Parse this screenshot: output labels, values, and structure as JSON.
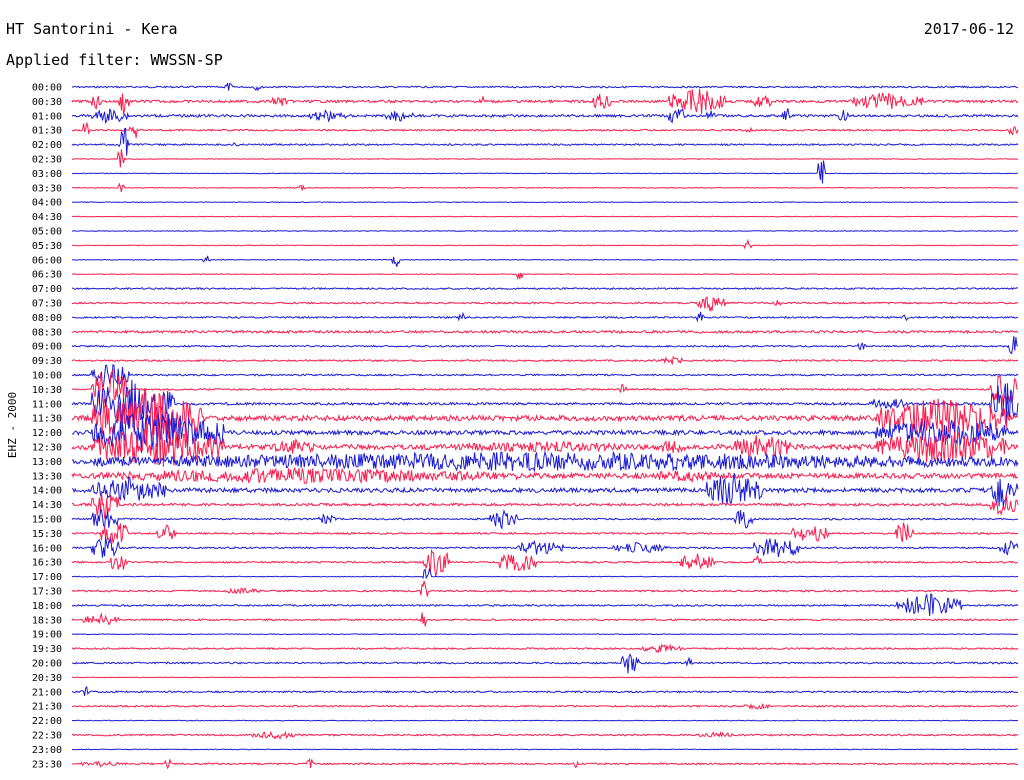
{
  "header": {
    "title": "HT Santorini - Kera",
    "date": "2017-06-12",
    "filter": "Applied filter: WWSSN-SP"
  },
  "chart_data": {
    "type": "line",
    "chart_kind": "helicorder",
    "channel_label": "EHZ - 2000",
    "colors": [
      "#1a1ad6",
      "#ff1a4b"
    ],
    "grid": false,
    "legend": "none",
    "rows": [
      {
        "label": "00:00",
        "level": 1,
        "events": [
          {
            "x": 0.16,
            "w": 0.01,
            "a": 5
          },
          {
            "x": 0.19,
            "w": 0.01,
            "a": 4
          }
        ]
      },
      {
        "label": "00:30",
        "level": 2,
        "events": [
          {
            "x": 0.02,
            "w": 0.01,
            "a": 8
          },
          {
            "x": 0.05,
            "w": 0.01,
            "a": 16
          },
          {
            "x": 0.21,
            "w": 0.02,
            "a": 6
          },
          {
            "x": 0.43,
            "w": 0.01,
            "a": 7
          },
          {
            "x": 0.55,
            "w": 0.02,
            "a": 10
          },
          {
            "x": 0.63,
            "w": 0.06,
            "a": 14
          },
          {
            "x": 0.72,
            "w": 0.02,
            "a": 8
          },
          {
            "x": 0.82,
            "w": 0.08,
            "a": 9
          }
        ]
      },
      {
        "label": "01:00",
        "level": 2,
        "events": [
          {
            "x": 0.02,
            "w": 0.04,
            "a": 8
          },
          {
            "x": 0.25,
            "w": 0.04,
            "a": 6
          },
          {
            "x": 0.33,
            "w": 0.03,
            "a": 6
          },
          {
            "x": 0.63,
            "w": 0.02,
            "a": 10
          },
          {
            "x": 0.67,
            "w": 0.01,
            "a": 6
          },
          {
            "x": 0.75,
            "w": 0.01,
            "a": 10
          },
          {
            "x": 0.81,
            "w": 0.01,
            "a": 9
          }
        ]
      },
      {
        "label": "01:30",
        "level": 1,
        "events": [
          {
            "x": 0.01,
            "w": 0.01,
            "a": 10
          },
          {
            "x": 0.06,
            "w": 0.01,
            "a": 14
          },
          {
            "x": 0.71,
            "w": 0.01,
            "a": 4
          },
          {
            "x": 0.99,
            "w": 0.01,
            "a": 6
          }
        ]
      },
      {
        "label": "02:00",
        "level": 1,
        "events": [
          {
            "x": 0.05,
            "w": 0.01,
            "a": 22
          },
          {
            "x": 0.17,
            "w": 0.005,
            "a": 4
          }
        ]
      },
      {
        "label": "02:30",
        "level": 0,
        "events": [
          {
            "x": 0.05,
            "w": 0.005,
            "a": 14
          }
        ]
      },
      {
        "label": "03:00",
        "level": 0,
        "events": [
          {
            "x": 0.79,
            "w": 0.005,
            "a": 20
          }
        ]
      },
      {
        "label": "03:30",
        "level": 0,
        "events": [
          {
            "x": 0.05,
            "w": 0.005,
            "a": 6
          },
          {
            "x": 0.24,
            "w": 0.005,
            "a": 3
          }
        ]
      },
      {
        "label": "04:00",
        "level": 0,
        "events": []
      },
      {
        "label": "04:30",
        "level": 0,
        "events": []
      },
      {
        "label": "05:00",
        "level": 0,
        "events": []
      },
      {
        "label": "05:30",
        "level": 0,
        "events": [
          {
            "x": 0.71,
            "w": 0.01,
            "a": 6
          }
        ]
      },
      {
        "label": "06:00",
        "level": 0,
        "events": [
          {
            "x": 0.14,
            "w": 0.005,
            "a": 5
          },
          {
            "x": 0.34,
            "w": 0.005,
            "a": 8
          }
        ]
      },
      {
        "label": "06:30",
        "level": 0,
        "events": [
          {
            "x": 0.47,
            "w": 0.005,
            "a": 8
          }
        ]
      },
      {
        "label": "07:00",
        "level": 1,
        "events": []
      },
      {
        "label": "07:30",
        "level": 1,
        "events": [
          {
            "x": 0.66,
            "w": 0.03,
            "a": 9
          },
          {
            "x": 0.74,
            "w": 0.01,
            "a": 4
          }
        ]
      },
      {
        "label": "08:00",
        "level": 1,
        "events": [
          {
            "x": 0.41,
            "w": 0.005,
            "a": 6
          },
          {
            "x": 0.66,
            "w": 0.01,
            "a": 6
          },
          {
            "x": 0.88,
            "w": 0.005,
            "a": 5
          }
        ]
      },
      {
        "label": "08:30",
        "level": 2,
        "events": []
      },
      {
        "label": "09:00",
        "level": 1,
        "events": [
          {
            "x": 0.83,
            "w": 0.01,
            "a": 4
          },
          {
            "x": 0.99,
            "w": 0.01,
            "a": 16
          }
        ]
      },
      {
        "label": "09:30",
        "level": 1,
        "events": [
          {
            "x": 0.62,
            "w": 0.03,
            "a": 4
          }
        ]
      },
      {
        "label": "10:00",
        "level": 1,
        "events": [
          {
            "x": 0.02,
            "w": 0.04,
            "a": 16
          }
        ]
      },
      {
        "label": "10:30",
        "level": 1,
        "events": [
          {
            "x": 0.02,
            "w": 0.04,
            "a": 22
          },
          {
            "x": 0.58,
            "w": 0.005,
            "a": 6
          },
          {
            "x": 0.97,
            "w": 0.03,
            "a": 20
          }
        ]
      },
      {
        "label": "11:00",
        "level": 2,
        "events": [
          {
            "x": 0.02,
            "w": 0.09,
            "a": 26
          },
          {
            "x": 0.84,
            "w": 0.04,
            "a": 8
          },
          {
            "x": 0.97,
            "w": 0.03,
            "a": 24
          }
        ]
      },
      {
        "label": "11:30",
        "level": 5,
        "events": [
          {
            "x": 0.02,
            "w": 0.12,
            "a": 30
          },
          {
            "x": 0.85,
            "w": 0.14,
            "a": 22
          }
        ]
      },
      {
        "label": "12:00",
        "level": 4,
        "events": [
          {
            "x": 0.02,
            "w": 0.14,
            "a": 24
          },
          {
            "x": 0.85,
            "w": 0.14,
            "a": 16
          }
        ]
      },
      {
        "label": "12:30",
        "level": 5,
        "events": [
          {
            "x": 0.02,
            "w": 0.14,
            "a": 22
          },
          {
            "x": 0.21,
            "w": 0.05,
            "a": 8
          },
          {
            "x": 0.4,
            "w": 0.2,
            "a": 6
          },
          {
            "x": 0.62,
            "w": 0.03,
            "a": 8
          },
          {
            "x": 0.7,
            "w": 0.06,
            "a": 14
          },
          {
            "x": 0.85,
            "w": 0.14,
            "a": 18
          }
        ]
      },
      {
        "label": "13:00",
        "level": 5,
        "events": [
          {
            "x": 0.02,
            "w": 0.98,
            "a": 10
          }
        ]
      },
      {
        "label": "13:30",
        "level": 5,
        "events": [
          {
            "x": 0.02,
            "w": 0.45,
            "a": 8
          },
          {
            "x": 0.6,
            "w": 0.1,
            "a": 6
          }
        ]
      },
      {
        "label": "14:00",
        "level": 4,
        "events": [
          {
            "x": 0.02,
            "w": 0.08,
            "a": 14
          },
          {
            "x": 0.67,
            "w": 0.06,
            "a": 18
          },
          {
            "x": 0.97,
            "w": 0.03,
            "a": 20
          }
        ]
      },
      {
        "label": "14:30",
        "level": 2,
        "events": [
          {
            "x": 0.02,
            "w": 0.03,
            "a": 16
          },
          {
            "x": 0.97,
            "w": 0.03,
            "a": 12
          }
        ]
      },
      {
        "label": "15:00",
        "level": 1,
        "events": [
          {
            "x": 0.02,
            "w": 0.03,
            "a": 12
          },
          {
            "x": 0.26,
            "w": 0.02,
            "a": 6
          },
          {
            "x": 0.44,
            "w": 0.03,
            "a": 10
          },
          {
            "x": 0.7,
            "w": 0.02,
            "a": 12
          }
        ]
      },
      {
        "label": "15:30",
        "level": 1,
        "events": [
          {
            "x": 0.03,
            "w": 0.03,
            "a": 14
          },
          {
            "x": 0.09,
            "w": 0.02,
            "a": 9
          },
          {
            "x": 0.76,
            "w": 0.04,
            "a": 10
          },
          {
            "x": 0.87,
            "w": 0.02,
            "a": 14
          }
        ]
      },
      {
        "label": "16:00",
        "level": 1,
        "events": [
          {
            "x": 0.02,
            "w": 0.03,
            "a": 14
          },
          {
            "x": 0.47,
            "w": 0.05,
            "a": 8
          },
          {
            "x": 0.57,
            "w": 0.06,
            "a": 6
          },
          {
            "x": 0.72,
            "w": 0.05,
            "a": 12
          },
          {
            "x": 0.98,
            "w": 0.02,
            "a": 8
          }
        ]
      },
      {
        "label": "16:30",
        "level": 1,
        "events": [
          {
            "x": 0.04,
            "w": 0.02,
            "a": 10
          },
          {
            "x": 0.37,
            "w": 0.03,
            "a": 16
          },
          {
            "x": 0.45,
            "w": 0.04,
            "a": 12
          },
          {
            "x": 0.64,
            "w": 0.04,
            "a": 10
          },
          {
            "x": 0.72,
            "w": 0.01,
            "a": 8
          }
        ]
      },
      {
        "label": "17:00",
        "level": 0,
        "events": [
          {
            "x": 0.37,
            "w": 0.01,
            "a": 12
          }
        ]
      },
      {
        "label": "17:30",
        "level": 1,
        "events": [
          {
            "x": 0.16,
            "w": 0.04,
            "a": 3
          },
          {
            "x": 0.37,
            "w": 0.005,
            "a": 14
          }
        ]
      },
      {
        "label": "18:00",
        "level": 1,
        "events": [
          {
            "x": 0.87,
            "w": 0.07,
            "a": 12
          }
        ]
      },
      {
        "label": "18:30",
        "level": 1,
        "events": [
          {
            "x": 0.01,
            "w": 0.04,
            "a": 6
          },
          {
            "x": 0.37,
            "w": 0.005,
            "a": 14
          }
        ]
      },
      {
        "label": "19:00",
        "level": 0,
        "events": []
      },
      {
        "label": "19:30",
        "level": 1,
        "events": [
          {
            "x": 0.6,
            "w": 0.05,
            "a": 4
          }
        ]
      },
      {
        "label": "20:00",
        "level": 1,
        "events": [
          {
            "x": 0.58,
            "w": 0.02,
            "a": 12
          },
          {
            "x": 0.65,
            "w": 0.005,
            "a": 6
          }
        ]
      },
      {
        "label": "20:30",
        "level": 0,
        "events": []
      },
      {
        "label": "21:00",
        "level": 1,
        "events": [
          {
            "x": 0.01,
            "w": 0.01,
            "a": 6
          }
        ]
      },
      {
        "label": "21:30",
        "level": 1,
        "events": [
          {
            "x": 0.71,
            "w": 0.03,
            "a": 3
          }
        ]
      },
      {
        "label": "22:00",
        "level": 0,
        "events": []
      },
      {
        "label": "22:30",
        "level": 1,
        "events": [
          {
            "x": 0.19,
            "w": 0.05,
            "a": 4
          },
          {
            "x": 0.66,
            "w": 0.04,
            "a": 3
          }
        ]
      },
      {
        "label": "23:00",
        "level": 0,
        "events": []
      },
      {
        "label": "23:30",
        "level": 1,
        "events": [
          {
            "x": 0.01,
            "w": 0.04,
            "a": 3
          },
          {
            "x": 0.1,
            "w": 0.005,
            "a": 8
          },
          {
            "x": 0.25,
            "w": 0.005,
            "a": 8
          },
          {
            "x": 0.53,
            "w": 0.005,
            "a": 4
          }
        ]
      }
    ]
  }
}
